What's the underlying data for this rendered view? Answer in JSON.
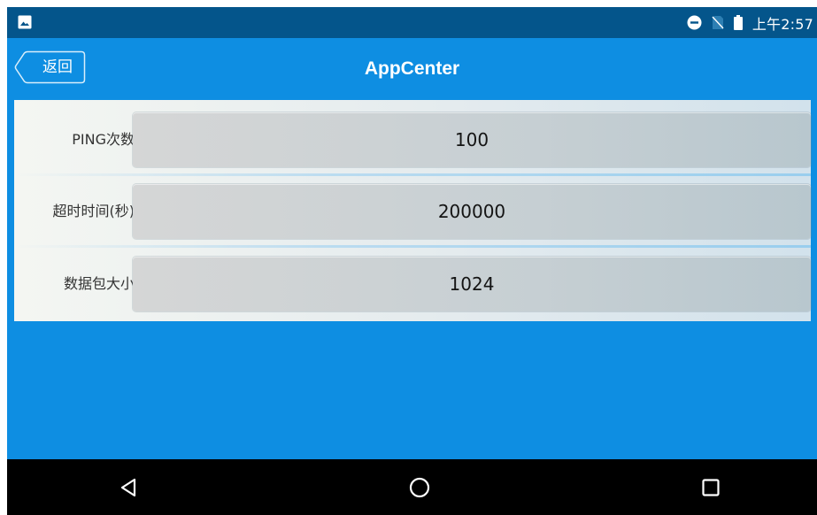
{
  "status_bar": {
    "time": "上午2:57",
    "icons": [
      "image-notification-icon",
      "do-not-disturb-icon",
      "no-sim-icon",
      "battery-icon"
    ]
  },
  "header": {
    "back_label": "返回",
    "title": "AppCenter"
  },
  "form": {
    "rows": [
      {
        "label": "PING次数",
        "value": "100"
      },
      {
        "label": "超时时间(秒)",
        "value": "200000"
      },
      {
        "label": "数据包大小",
        "value": "1024"
      }
    ]
  },
  "nav_bar": {
    "buttons": [
      "back-icon",
      "home-icon",
      "recents-icon"
    ]
  },
  "colors": {
    "status_bar": "#04558b",
    "accent": "#0e8ee2",
    "nav_bar": "#000000"
  }
}
